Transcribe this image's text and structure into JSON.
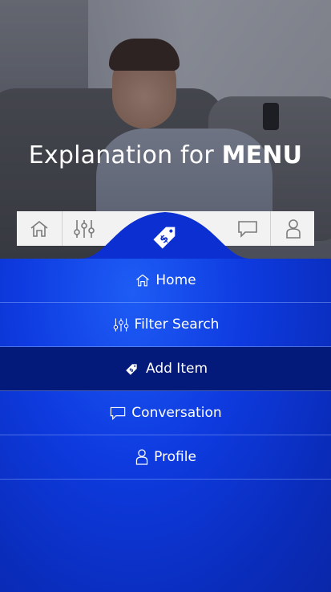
{
  "hero": {
    "title_prefix": "Explanation for ",
    "title_bold": "MENU"
  },
  "tabbar": {
    "tabs": [
      {
        "icon": "home-icon"
      },
      {
        "icon": "sliders-icon"
      },
      {
        "icon": "price-tag-icon",
        "active": true
      },
      {
        "icon": "chat-bubble-icon"
      },
      {
        "icon": "user-icon"
      }
    ],
    "accent": "#0b2fd0"
  },
  "menu": {
    "items": [
      {
        "label": "Home",
        "icon": "home-icon"
      },
      {
        "label": "Filter Search",
        "icon": "sliders-icon"
      },
      {
        "label": "Add Item",
        "icon": "price-tag-icon",
        "active": true
      },
      {
        "label": "Conversation",
        "icon": "chat-bubble-icon"
      },
      {
        "label": "Profile",
        "icon": "user-icon"
      }
    ],
    "active_color": "#041a7a"
  }
}
